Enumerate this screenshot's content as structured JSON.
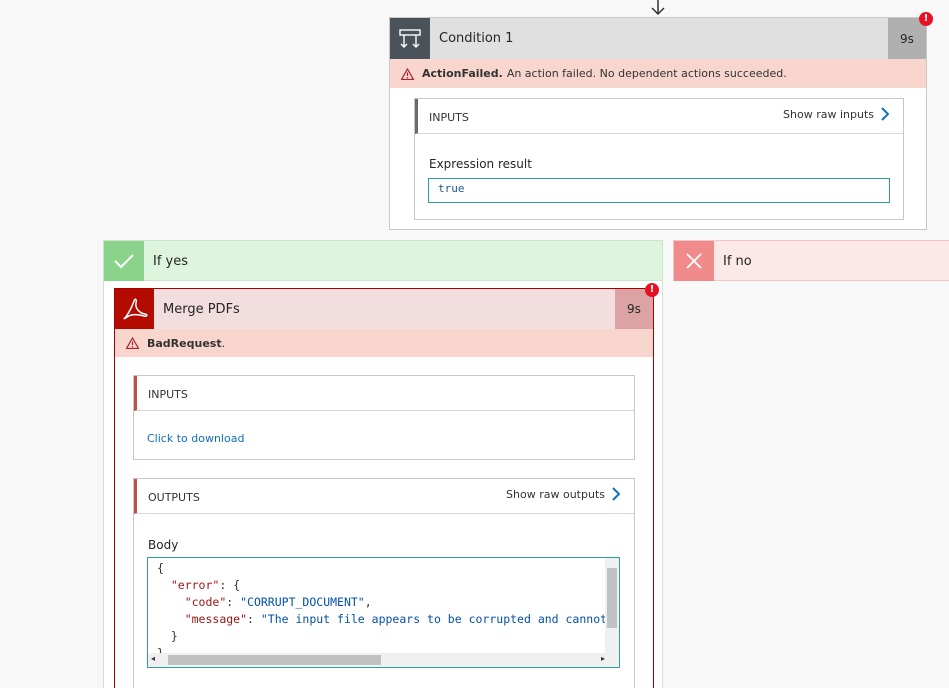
{
  "condition": {
    "title": "Condition 1",
    "duration": "9s",
    "error_badge": "!",
    "error_code": "ActionFailed.",
    "error_message": "An action failed. No dependent actions succeeded.",
    "inputs": {
      "header": "INPUTS",
      "show_raw_label": "Show raw inputs",
      "field_label": "Expression result",
      "field_value": "true"
    }
  },
  "if_yes": {
    "label": "If yes"
  },
  "if_no": {
    "label": "If no"
  },
  "merge_pdfs": {
    "title": "Merge PDFs",
    "duration": "9s",
    "error_badge": "!",
    "error_code": "BadRequest",
    "error_suffix": ".",
    "inputs": {
      "header": "INPUTS",
      "download_link": "Click to download"
    },
    "outputs": {
      "header": "OUTPUTS",
      "show_raw_label": "Show raw outputs",
      "body_label": "Body",
      "body_lines": {
        "open": "{",
        "error_key": "\"error\"",
        "error_open": ": {",
        "code_key": "\"code\"",
        "code_value": "\"CORRUPT_DOCUMENT\"",
        "message_key": "\"message\"",
        "message_value": "\"The input file appears to be corrupted and cannot b",
        "inner_close": "}",
        "close": "}"
      }
    }
  },
  "colors": {
    "accent_teal": "#2d9fa0",
    "error_red": "#e81123",
    "link_blue": "#106ebe",
    "success_green": "#8bd38b",
    "failure_red": "#f18a8a"
  }
}
